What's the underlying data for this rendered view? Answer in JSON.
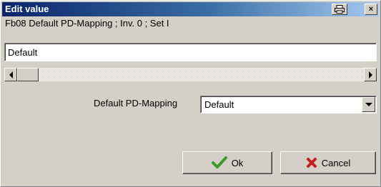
{
  "window": {
    "title": "Edit value"
  },
  "description": "Fb08 Default PD-Mapping ; Inv. 0 ; Set I",
  "value_input": {
    "value": "Default"
  },
  "mapping": {
    "label": "Default PD-Mapping",
    "selected": "Default"
  },
  "buttons": {
    "ok_label": "Ok",
    "cancel_label": "Cancel"
  },
  "titlebar_buttons": {
    "close_glyph": "×"
  },
  "colors": {
    "title_start": "#0a246a",
    "title_end": "#a6caf0",
    "ok_check": "#3c9a2a",
    "cancel_x": "#c81e1e"
  },
  "icons": {
    "print": "print-icon",
    "close": "close-icon",
    "ok": "checkmark-icon",
    "cancel": "cross-icon"
  }
}
